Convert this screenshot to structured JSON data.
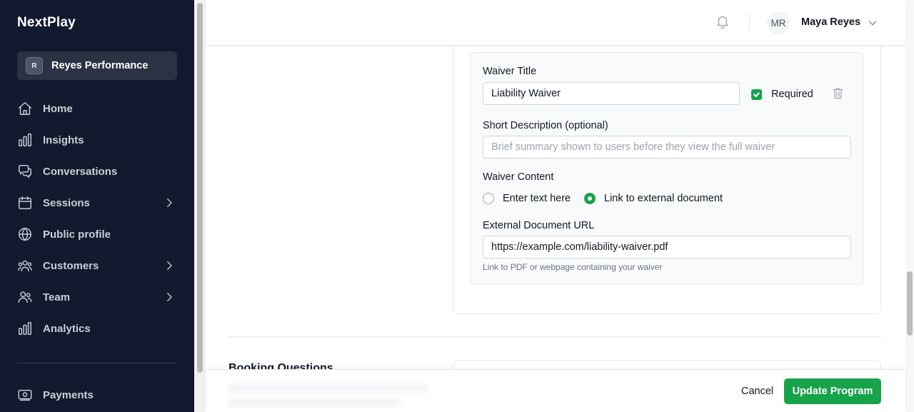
{
  "brand": "NextPlay",
  "org": {
    "initial": "R",
    "name": "Reyes Performance"
  },
  "nav": [
    {
      "label": "Home",
      "icon": "home-icon",
      "has_chevron": false
    },
    {
      "label": "Insights",
      "icon": "bar-chart-icon",
      "has_chevron": false
    },
    {
      "label": "Conversations",
      "icon": "chat-bubbles-icon",
      "has_chevron": false
    },
    {
      "label": "Sessions",
      "icon": "calendar-icon",
      "has_chevron": true
    },
    {
      "label": "Public profile",
      "icon": "globe-icon",
      "has_chevron": false
    },
    {
      "label": "Customers",
      "icon": "users-group-icon",
      "has_chevron": true
    },
    {
      "label": "Team",
      "icon": "team-icon",
      "has_chevron": true
    },
    {
      "label": "Analytics",
      "icon": "bar-chart-icon",
      "has_chevron": false
    },
    {
      "label": "Payments",
      "icon": "payments-icon",
      "has_chevron": false
    }
  ],
  "header": {
    "user_initials": "MR",
    "user_name": "Maya Reyes"
  },
  "waiver": {
    "title_label": "Waiver Title",
    "title_value": "Liability Waiver",
    "required_label": "Required",
    "required_checked": true,
    "description_label": "Short Description (optional)",
    "description_placeholder": "Brief summary shown to users before they view the full waiver",
    "content_label": "Waiver Content",
    "content_options": [
      "Enter text here",
      "Link to external document"
    ],
    "content_selected": "Link to external document",
    "url_label": "External Document URL",
    "url_value": "https://example.com/liability-waiver.pdf",
    "url_hint": "Link to PDF or webpage containing your waiver"
  },
  "sections": {
    "booking_questions_title": "Booking Questions"
  },
  "actions": {
    "cancel_label": "Cancel",
    "submit_label": "Update Program"
  },
  "colors": {
    "sidebar_bg": "#111a2e",
    "accent_green": "#16a34a",
    "org_bg": "#2a3244"
  }
}
